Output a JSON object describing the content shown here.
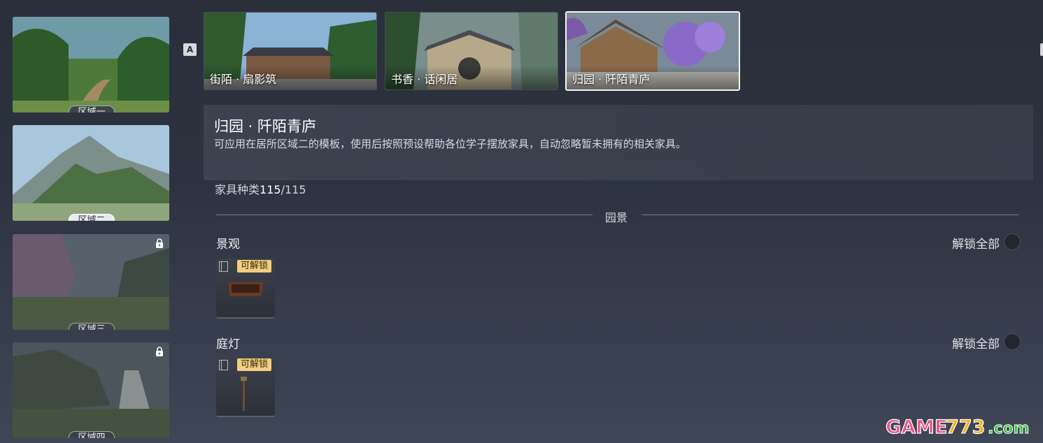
{
  "regions": [
    {
      "label": "区域一",
      "locked": false
    },
    {
      "label": "区域二",
      "locked": false,
      "active": true
    },
    {
      "label": "区域三",
      "locked": true
    },
    {
      "label": "区域四",
      "locked": true
    }
  ],
  "key_hint": "A",
  "templates": [
    {
      "label": "街陌 · 扇影筑"
    },
    {
      "label": "书香 · 话闲居"
    },
    {
      "label": "归园 · 阡陌青庐",
      "selected": true
    }
  ],
  "panel": {
    "title": "归园 · 阡陌青庐",
    "description": "可应用在居所区域二的模板，使用后按照预设帮助各位学子摆放家具，自动忽略暂未拥有的相关家具。",
    "count_label": "家具种类",
    "count_value": "115",
    "count_total": "/115"
  },
  "section": {
    "label": "园景"
  },
  "categories": [
    {
      "title": "景观",
      "unlock_all": "解锁全部",
      "items": [
        {
          "badge": "可解锁"
        }
      ]
    },
    {
      "title": "庭灯",
      "unlock_all": "解锁全部",
      "items": [
        {
          "badge": "可解锁"
        }
      ]
    }
  ],
  "watermark": "GAME773.com"
}
